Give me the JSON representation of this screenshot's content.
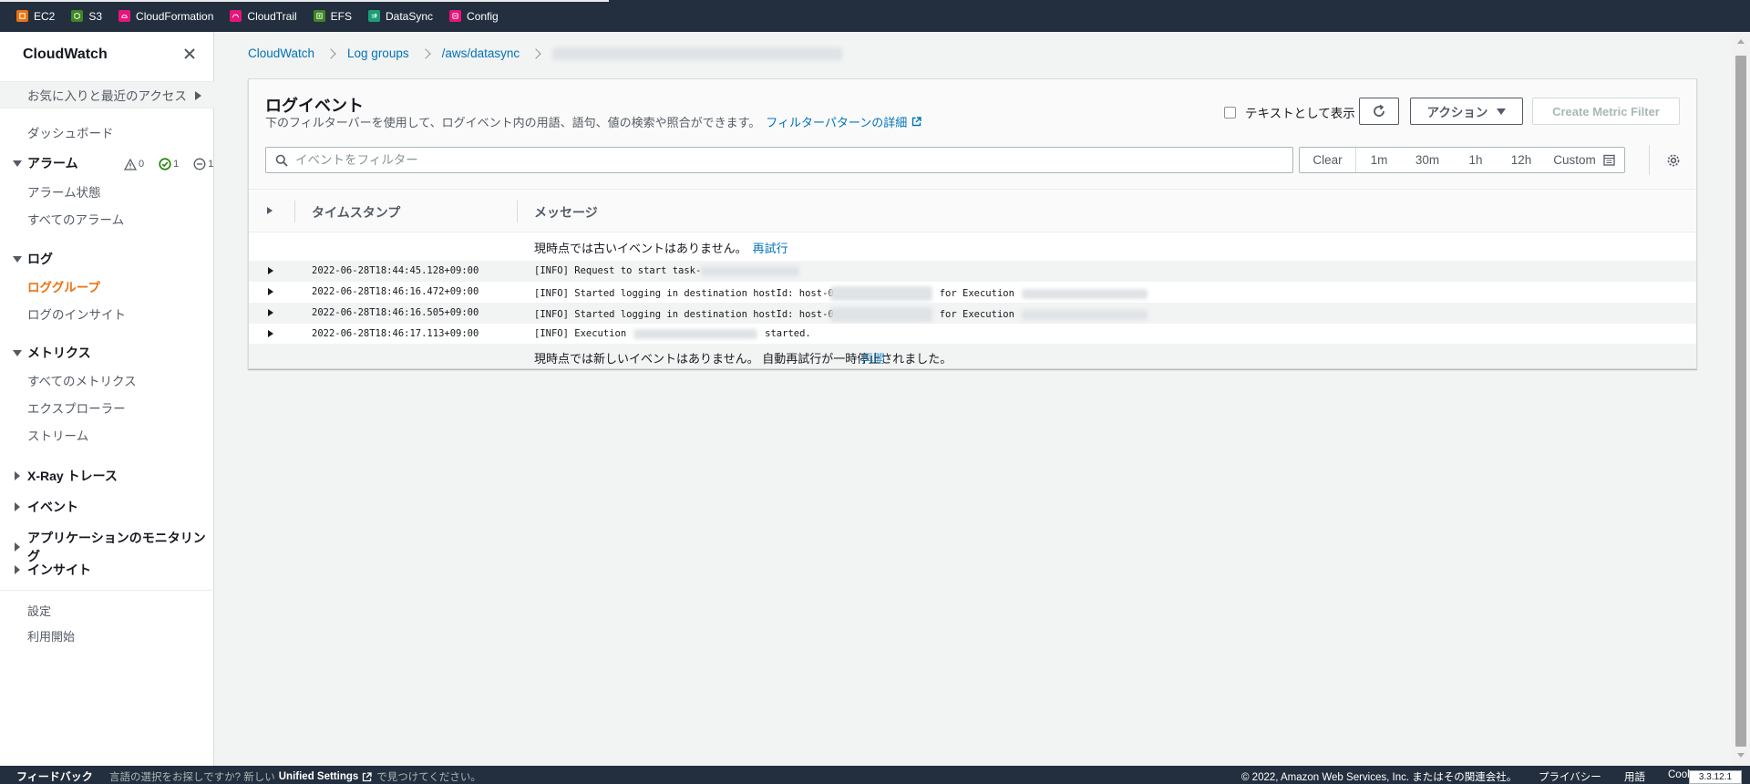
{
  "services": [
    {
      "label": "EC2",
      "color": "#ec7211",
      "icon": "ec2-icon"
    },
    {
      "label": "S3",
      "color": "#3f8624",
      "icon": "s3-icon"
    },
    {
      "label": "CloudFormation",
      "color": "#e7157b",
      "icon": "cloudformation-icon"
    },
    {
      "label": "CloudTrail",
      "color": "#e7157b",
      "icon": "cloudtrail-icon"
    },
    {
      "label": "EFS",
      "color": "#3f8624",
      "icon": "efs-icon"
    },
    {
      "label": "DataSync",
      "color": "#1b9e77",
      "icon": "datasync-icon"
    },
    {
      "label": "Config",
      "color": "#e7157b",
      "icon": "config-icon"
    }
  ],
  "sidebar": {
    "title": "CloudWatch",
    "favorites": "お気に入りと最近のアクセス",
    "dashboard": "ダッシュボード",
    "alarms": {
      "label": "アラーム",
      "counts": {
        "alarm": "0",
        "ok": "1",
        "insufficient": "1"
      },
      "items": [
        "アラーム状態",
        "すべてのアラーム"
      ]
    },
    "logs": {
      "label": "ログ",
      "items": [
        "ロググループ",
        "ログのインサイト"
      ],
      "active": "ロググループ"
    },
    "metrics": {
      "label": "メトリクス",
      "items": [
        "すべてのメトリクス",
        "エクスプローラー",
        "ストリーム"
      ]
    },
    "collapsed_sections": [
      "X-Ray トレース",
      "イベント",
      "アプリケーションのモニタリング",
      "インサイト"
    ],
    "bottom_links": [
      "設定",
      "利用開始"
    ]
  },
  "breadcrumb": [
    "CloudWatch",
    "Log groups",
    "/aws/datasync"
  ],
  "panel": {
    "title": "ログイベント",
    "description": "下のフィルターバーを使用して、ログイベント内の用語、語句、値の検索や照合ができます。",
    "description_link": "フィルターパターンの詳細",
    "view_as_text": "テキストとして表示",
    "actions_label": "アクション",
    "create_metric_filter": "Create Metric Filter",
    "search_placeholder": "イベントをフィルター",
    "time_range": [
      "Clear",
      "1m",
      "30m",
      "1h",
      "12h",
      "Custom"
    ],
    "columns": [
      "タイムスタンプ",
      "メッセージ"
    ],
    "older_notice": "現時点では古いイベントはありません。",
    "retry_link": "再試行",
    "newer_notice": "現時点では新しいイベントはありません。 自動再試行が一時停止されました。",
    "newer_link": "再開",
    "events": [
      {
        "timestamp": "2022-06-28T18:44:45.128+09:00",
        "message": "[INFO] Request to start task-"
      },
      {
        "timestamp": "2022-06-28T18:46:16.472+09:00",
        "message": "[INFO] Started logging in destination hostId: host-0",
        "message_b": "for Execution"
      },
      {
        "timestamp": "2022-06-28T18:46:16.505+09:00",
        "message": "[INFO] Started logging in destination hostId: host-0",
        "message_b": "for Execution"
      },
      {
        "timestamp": "2022-06-28T18:46:17.113+09:00",
        "message": "[INFO] Execution",
        "message_b": "started."
      }
    ]
  },
  "footer": {
    "feedback": "フィードバック",
    "lang_prefix": "言語の選択をお探しですか? 新しい",
    "lang_link": "Unified Settings",
    "lang_suffix": "で見つけてください。",
    "copyright": "© 2022, Amazon Web Services, Inc. またはその関連会社。",
    "privacy": "プライバシー",
    "terms": "用語",
    "cookie": "Cook",
    "version": "3.3.12.1"
  }
}
